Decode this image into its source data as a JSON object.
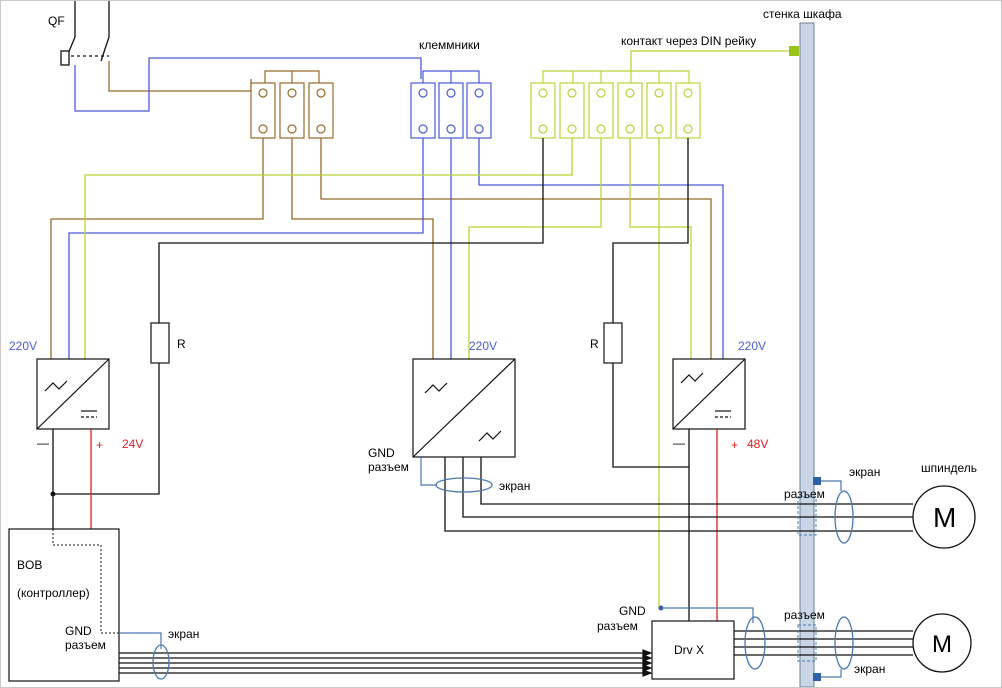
{
  "labels": {
    "qf": "QF",
    "klemmniki": "клеммники",
    "din_contact": "контакт через DIN рейку",
    "cabinet_wall": "стенка шкафа",
    "v220_left": "220V",
    "v220_mid": "220V",
    "v220_right": "220V",
    "resistor_left": "R",
    "resistor_right": "R",
    "minus_left": "—",
    "plus_left": "+",
    "v24": "24V",
    "minus_right": "—",
    "plus_right": "+",
    "v48": "48V",
    "gnd_mid_1": "GND",
    "gnd_mid_2": "разъем",
    "shield_mid": "экран",
    "spindle": "шпиндель",
    "connector_spindle": "разъем",
    "shield_spindle": "экран",
    "motor_spindle": "M",
    "bob_1": "BOB",
    "bob_2": "(контроллер)",
    "gnd_bob_1": "GND",
    "gnd_bob_2": "разъем",
    "shield_bob": "экран",
    "gnd_drv_1": "GND",
    "gnd_drv_2": "разъем",
    "drv": "Drv X",
    "connector_motor": "разъем",
    "shield_motor": "экран",
    "motor_x": "M"
  },
  "colors": {
    "brown": "#9a6a2a",
    "blue": "#4a5bd6",
    "yellow_green": "#b7d435",
    "black": "#111111",
    "red": "#e02020",
    "steel_blue": "#4a78b0",
    "wall_fill": "#c9d6e6",
    "wall_stroke": "#6e7f96",
    "din_green": "#9bc41a"
  }
}
